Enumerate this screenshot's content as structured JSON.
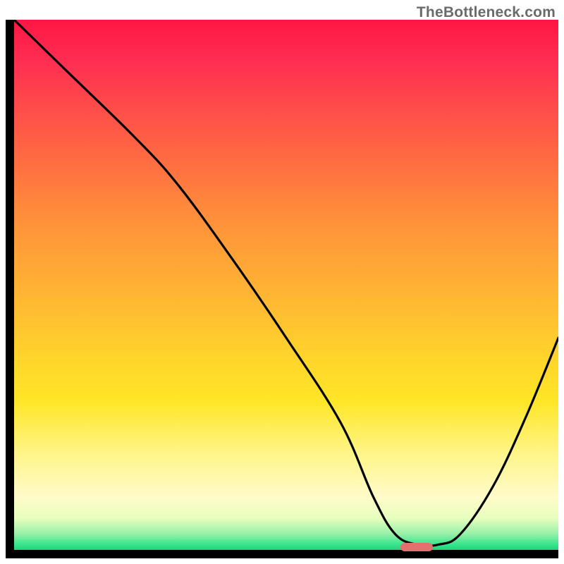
{
  "watermark": "TheBottleneck.com",
  "chart_data": {
    "type": "line",
    "title": "",
    "xlabel": "",
    "ylabel": "",
    "xlim": [
      0,
      100
    ],
    "ylim": [
      0,
      100
    ],
    "x": [
      0,
      10,
      22,
      30,
      40,
      50,
      60,
      66,
      70,
      74,
      78,
      82,
      88,
      94,
      100
    ],
    "values": [
      100,
      90,
      78,
      69,
      55,
      40,
      24,
      10,
      3,
      1,
      1,
      3,
      12,
      25,
      40
    ],
    "marker": {
      "x_start": 71,
      "x_end": 77,
      "y": 0.5
    },
    "background_gradient": {
      "top": "#ff1744",
      "mid": "#ffd02c",
      "bottom": "#26d07c"
    }
  }
}
